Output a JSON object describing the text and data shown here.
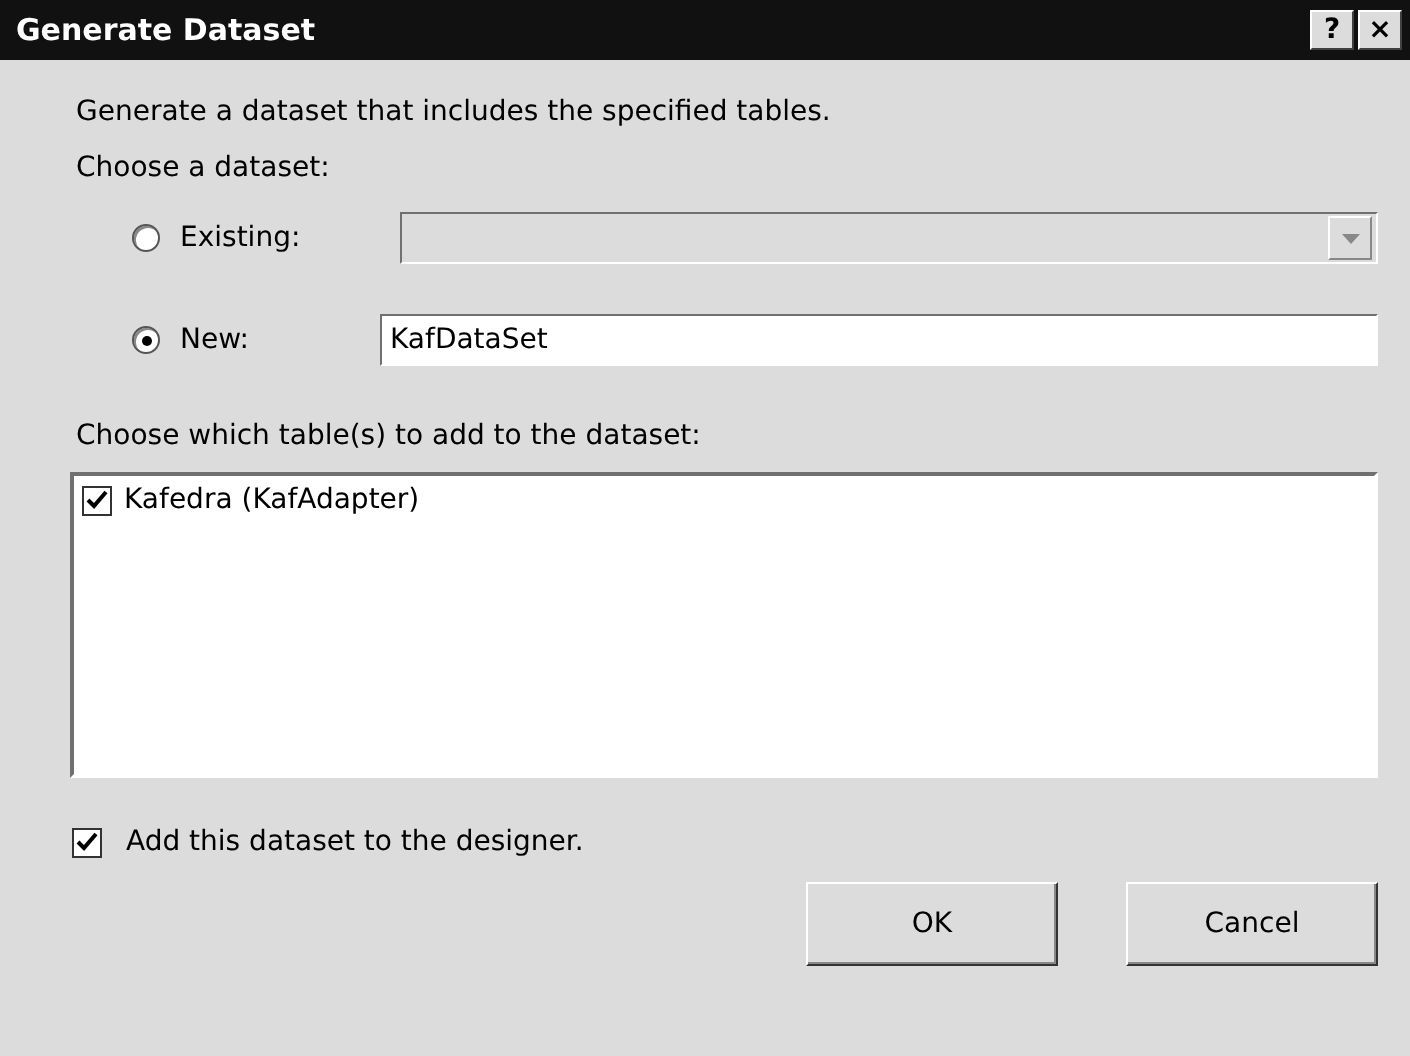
{
  "window": {
    "title": "Generate Dataset",
    "title_buttons": [
      "?",
      "×"
    ]
  },
  "intro": "Generate a dataset that includes the specified tables.",
  "choose_label": "Choose a dataset:",
  "options": [
    {
      "label": "Existing:",
      "selected": false,
      "kind": "combo",
      "disabled": true
    },
    {
      "label": "New:",
      "selected": true,
      "kind": "text",
      "value": "KafDataSet"
    }
  ],
  "tables_label": "Choose which table(s) to add to the dataset:",
  "tables": [
    {
      "label": "Kafedra (KafAdapter)",
      "checked": true
    }
  ],
  "add_to_designer": {
    "label": "Add this dataset to the designer.",
    "checked": true
  },
  "buttons": [
    "OK",
    "Cancel"
  ]
}
